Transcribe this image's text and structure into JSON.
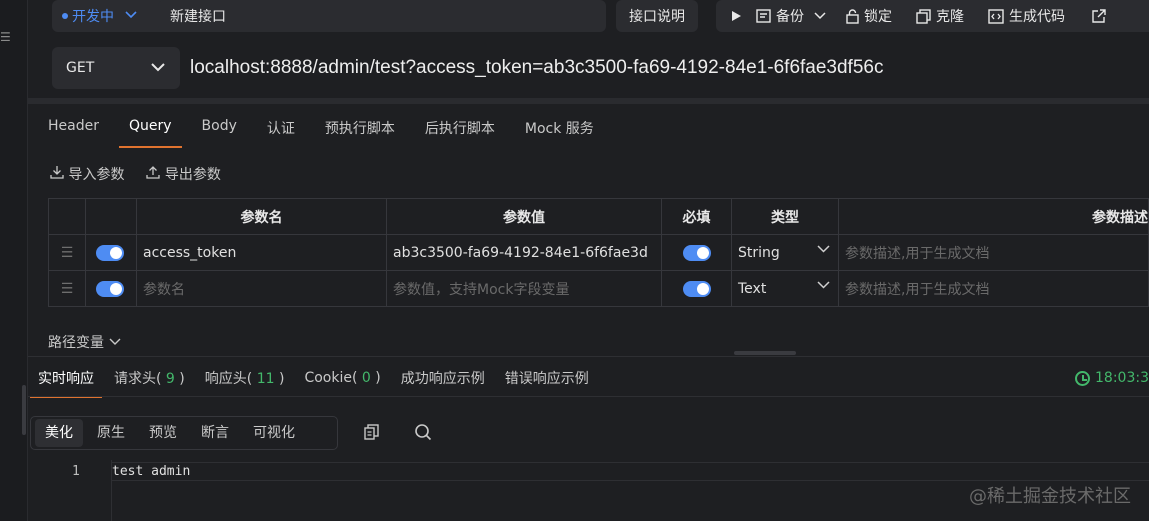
{
  "topbar": {
    "status": "开发中",
    "name": "新建接口",
    "doc_button": "接口说明",
    "actions": {
      "backup": "备份",
      "lock": "锁定",
      "clone": "克隆",
      "codegen": "生成代码"
    }
  },
  "request": {
    "method": "GET",
    "url": "localhost:8888/admin/test?access_token=ab3c3500-fa69-4192-84e1-6f6fae3df56c"
  },
  "tabs": [
    "Header",
    "Query",
    "Body",
    "认证",
    "预执行脚本",
    "后执行脚本",
    "Mock 服务"
  ],
  "active_tab": "Query",
  "param_tools": {
    "import": "导入参数",
    "export": "导出参数"
  },
  "params_table": {
    "headers": {
      "name": "参数名",
      "value": "参数值",
      "required": "必填",
      "type": "类型",
      "desc": "参数描述"
    },
    "rows": [
      {
        "name": "access_token",
        "value": "ab3c3500-fa69-4192-84e1-6f6fae3d",
        "type": "String",
        "desc_placeholder": "参数描述,用于生成文档"
      },
      {
        "name_placeholder": "参数名",
        "value_placeholder": "参数值，支持Mock字段变量",
        "type": "Text",
        "desc_placeholder": "参数描述,用于生成文档"
      }
    ]
  },
  "path_variables": "路径变量",
  "response": {
    "tabs": {
      "realtime": "实时响应",
      "req_headers": "请求头",
      "req_headers_count": "9",
      "resp_headers": "响应头",
      "resp_headers_count": "11",
      "cookie": "Cookie",
      "cookie_count": "0",
      "success_example": "成功响应示例",
      "error_example": "错误响应示例"
    },
    "time": "18:03:3",
    "views": [
      "美化",
      "原生",
      "预览",
      "断言",
      "可视化"
    ],
    "active_view": "美化",
    "lines": [
      {
        "n": "1",
        "text": "test admin"
      }
    ]
  },
  "watermark": "@稀土掘金技术社区",
  "colors": {
    "accent_blue": "#4e8cf3",
    "accent_orange": "#e0732f",
    "success_green": "#43b86b",
    "background": "#1e1f22"
  }
}
